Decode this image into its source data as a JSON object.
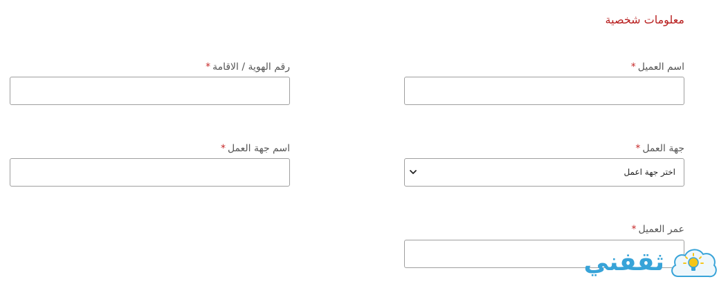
{
  "section": {
    "title": "معلومات شخصية"
  },
  "required_mark": "*",
  "fields": {
    "customer_name": {
      "label": "اسم العميل",
      "value": ""
    },
    "id_number": {
      "label": "رقم الهوية / الاقامة",
      "value": ""
    },
    "employer": {
      "label": "جهة العمل",
      "selected": "اختر جهة اعمل"
    },
    "employer_name": {
      "label": "اسم جهة العمل",
      "value": ""
    },
    "customer_age": {
      "label": "عمر العميل",
      "value": ""
    }
  },
  "watermark": {
    "text": "ثقفني",
    "icon": "lightbulb-icon"
  },
  "colors": {
    "title": "#b71c1c",
    "required": "#c62828",
    "border": "#9e9e9e",
    "watermark": "#37a3d8"
  }
}
